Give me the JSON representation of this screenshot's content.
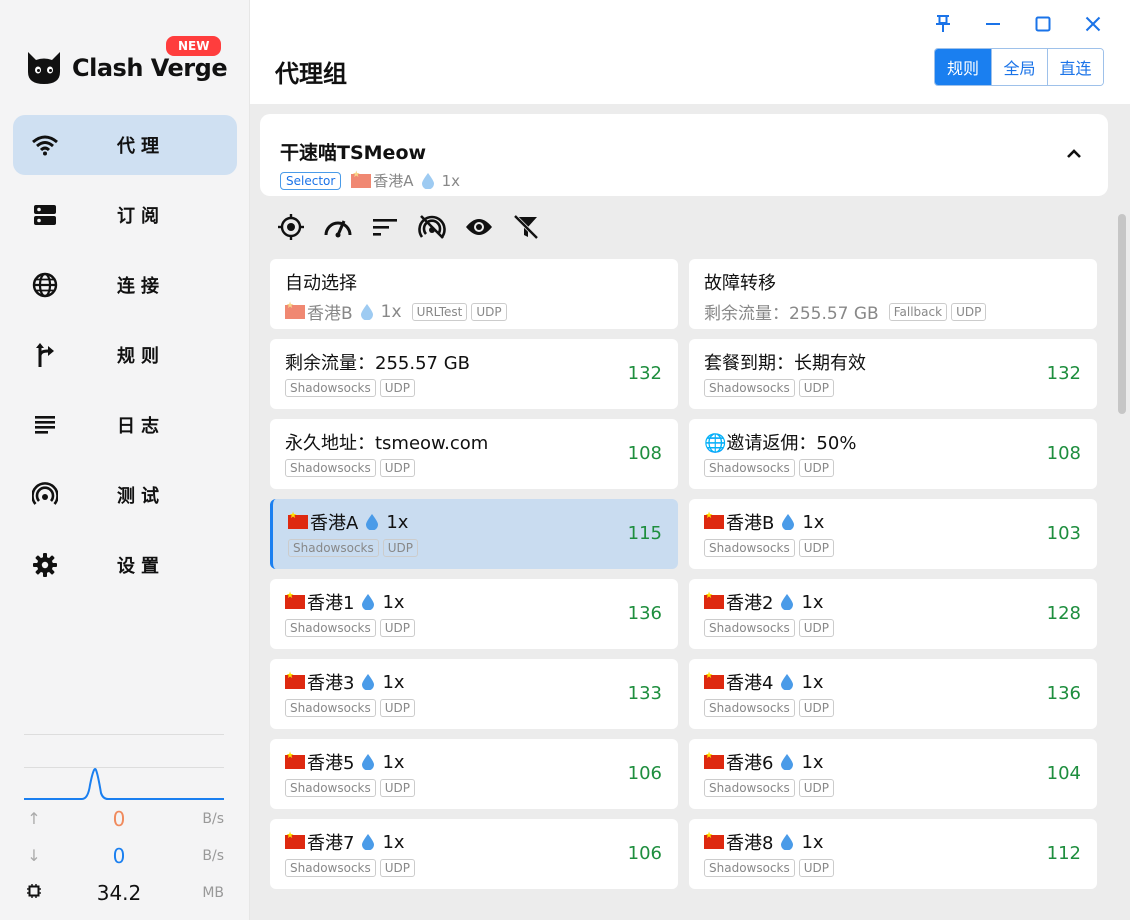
{
  "sidebar": {
    "brand": "Clash Verge",
    "badge": "NEW",
    "items": [
      {
        "label": "代理",
        "icon": "wifi-icon",
        "active": true
      },
      {
        "label": "订阅",
        "icon": "dns-icon",
        "active": false
      },
      {
        "label": "连接",
        "icon": "globe-icon",
        "active": false
      },
      {
        "label": "规则",
        "icon": "fork-arrow-icon",
        "active": false
      },
      {
        "label": "日志",
        "icon": "list-icon",
        "active": false
      },
      {
        "label": "测试",
        "icon": "radar-icon",
        "active": false
      },
      {
        "label": "设置",
        "icon": "gear-icon",
        "active": false
      }
    ],
    "traffic": {
      "up": "0",
      "up_unit": "B/s",
      "up_color": "#f08a5d",
      "down": "0",
      "down_unit": "B/s",
      "down_color": "#1a7ff0",
      "memory": "34.2",
      "memory_unit": "MB"
    }
  },
  "header": {
    "title": "代理组",
    "modes": [
      {
        "label": "规则",
        "active": true
      },
      {
        "label": "全局",
        "active": false
      },
      {
        "label": "直连",
        "active": false
      }
    ]
  },
  "group": {
    "name": "干速喵TSMeow",
    "type": "Selector",
    "current": "香港A",
    "multiplier": "1x"
  },
  "toolbar_icons": [
    "locate-icon",
    "speed-test-icon",
    "sort-icon",
    "wifi-off-icon",
    "eye-icon",
    "filter-off-icon"
  ],
  "proxies": [
    {
      "name": "自动选择",
      "flag": false,
      "sub_flag": true,
      "sub": "香港B",
      "sub_mult": "1x",
      "tags": [
        "URLTest",
        "UDP"
      ],
      "delay": ""
    },
    {
      "name": "故障转移",
      "flag": false,
      "sub_flag": false,
      "sub": "剩余流量：255.57 GB",
      "sub_mult": "",
      "tags": [
        "Fallback",
        "UDP"
      ],
      "delay": ""
    },
    {
      "name": "剩余流量：255.57 GB",
      "flag": false,
      "tags": [
        "Shadowsocks",
        "UDP"
      ],
      "delay": "132"
    },
    {
      "name": "套餐到期：长期有效",
      "flag": false,
      "tags": [
        "Shadowsocks",
        "UDP"
      ],
      "delay": "132"
    },
    {
      "name": "永久地址：tsmeow.com",
      "flag": false,
      "tags": [
        "Shadowsocks",
        "UDP"
      ],
      "delay": "108"
    },
    {
      "name": "🌐邀请返佣：50%",
      "flag": false,
      "tags": [
        "Shadowsocks",
        "UDP"
      ],
      "delay": "108"
    },
    {
      "name": "香港A",
      "flag": true,
      "mult": "1x",
      "tags": [
        "Shadowsocks",
        "UDP"
      ],
      "delay": "115",
      "selected": true
    },
    {
      "name": "香港B",
      "flag": true,
      "mult": "1x",
      "tags": [
        "Shadowsocks",
        "UDP"
      ],
      "delay": "103"
    },
    {
      "name": "香港1",
      "flag": true,
      "mult": "1x",
      "tags": [
        "Shadowsocks",
        "UDP"
      ],
      "delay": "136"
    },
    {
      "name": "香港2",
      "flag": true,
      "mult": "1x",
      "tags": [
        "Shadowsocks",
        "UDP"
      ],
      "delay": "128"
    },
    {
      "name": "香港3",
      "flag": true,
      "mult": "1x",
      "tags": [
        "Shadowsocks",
        "UDP"
      ],
      "delay": "133"
    },
    {
      "name": "香港4",
      "flag": true,
      "mult": "1x",
      "tags": [
        "Shadowsocks",
        "UDP"
      ],
      "delay": "136"
    },
    {
      "name": "香港5",
      "flag": true,
      "mult": "1x",
      "tags": [
        "Shadowsocks",
        "UDP"
      ],
      "delay": "106"
    },
    {
      "name": "香港6",
      "flag": true,
      "mult": "1x",
      "tags": [
        "Shadowsocks",
        "UDP"
      ],
      "delay": "104"
    },
    {
      "name": "香港7",
      "flag": true,
      "mult": "1x",
      "tags": [
        "Shadowsocks",
        "UDP"
      ],
      "delay": "106"
    },
    {
      "name": "香港8",
      "flag": true,
      "mult": "1x",
      "tags": [
        "Shadowsocks",
        "UDP"
      ],
      "delay": "112"
    }
  ]
}
